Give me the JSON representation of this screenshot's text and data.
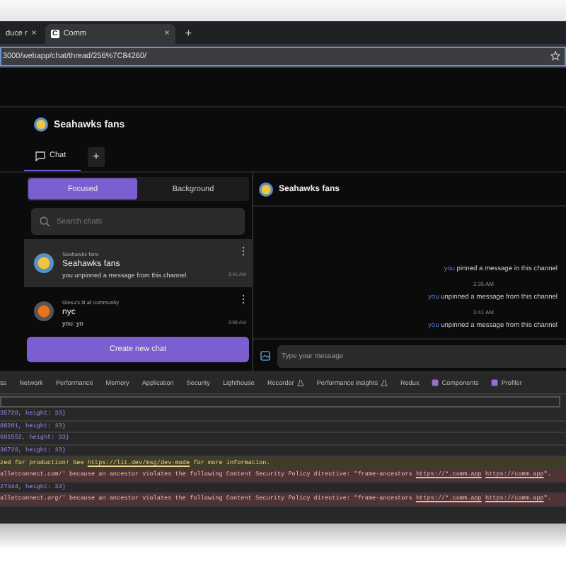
{
  "browser": {
    "tabs": [
      {
        "title": "duce r",
        "close": "×",
        "selected": false
      },
      {
        "title": "Comm",
        "favicon": "C",
        "close": "×",
        "selected": true
      }
    ],
    "new_tab": "+",
    "url": "3000/webapp/chat/thread/256%7C84260/"
  },
  "app": {
    "community": "Seahawks fans",
    "tabs": [
      {
        "label": "Chat",
        "selected": true
      }
    ],
    "add_tab": "+",
    "filters": [
      {
        "label": "Focused",
        "selected": true
      },
      {
        "label": "Background",
        "selected": false
      }
    ],
    "search": {
      "placeholder": "Search chats"
    },
    "chats": [
      {
        "community": "Seahawks fans",
        "name": "Seahawks fans",
        "preview": "you unpinned a message from this channel",
        "time": "3:41 AM",
        "selected": true
      },
      {
        "community": "Ginsu's lit af community",
        "name": "nyc",
        "preview": "you: yo",
        "time": "3:09 AM",
        "selected": false
      }
    ],
    "create_button": "Create new chat",
    "thread": {
      "title": "Seahawks fans",
      "messages": [
        {
          "kind": "event",
          "actor": "you",
          "text": "pinned a message in this channel"
        },
        {
          "kind": "time",
          "text": "3:35 AM"
        },
        {
          "kind": "event",
          "actor": "you",
          "text": "unpinned a message from this channel"
        },
        {
          "kind": "time",
          "text": "3:41 AM"
        },
        {
          "kind": "event",
          "actor": "you",
          "text": "unpinned a message from this channel"
        }
      ],
      "input": {
        "placeholder": "Type your message"
      }
    }
  },
  "devtools": {
    "tabs": [
      {
        "label": "ss",
        "kind": "plain"
      },
      {
        "label": "Network",
        "kind": "plain"
      },
      {
        "label": "Performance",
        "kind": "plain"
      },
      {
        "label": "Memory",
        "kind": "plain"
      },
      {
        "label": "Application",
        "kind": "plain"
      },
      {
        "label": "Security",
        "kind": "plain"
      },
      {
        "label": "Lighthouse",
        "kind": "plain"
      },
      {
        "label": "Recorder",
        "kind": "experimental"
      },
      {
        "label": "Performance insights",
        "kind": "experimental"
      },
      {
        "label": "Redux",
        "kind": "plain"
      },
      {
        "label": "Components",
        "kind": "extension"
      },
      {
        "label": "Profiler",
        "kind": "extension"
      }
    ],
    "console": [
      {
        "kind": "log",
        "text": "35728, height: 33}"
      },
      {
        "kind": "log",
        "text": "88281, height: 33}"
      },
      {
        "kind": "log",
        "text": "681552, height: 33}"
      },
      {
        "kind": "log",
        "text": "36728, height: 33}"
      },
      {
        "kind": "warning",
        "text": "zed for production! See ",
        "link": "https://lit.dev/msg/dev-mode",
        "after": " for more information."
      },
      {
        "kind": "error",
        "text": "alletconnect.com/' because an ancestor violates the following Content Security Policy directive: \"frame-ancestors ",
        "link": "https://*.comm.app",
        "link2": "https://comm.app",
        "after": "\"."
      },
      {
        "kind": "log",
        "text": "27344, height: 33}"
      },
      {
        "kind": "error",
        "text": "alletconnect.org/' because an ancestor violates the following Content Security Policy directive: \"frame-ancestors ",
        "link": "https://*.comm.app",
        "link2": "https://comm.app",
        "after": "\"."
      }
    ]
  }
}
